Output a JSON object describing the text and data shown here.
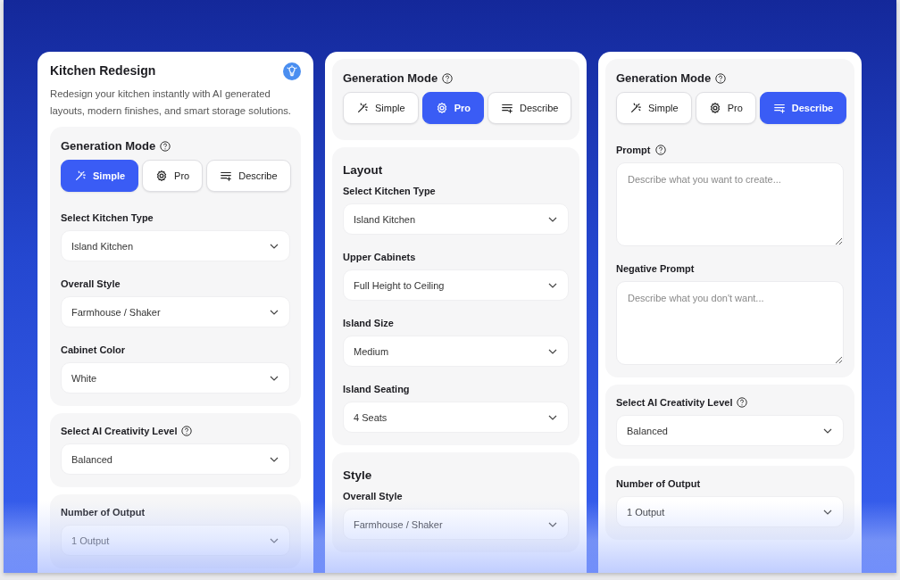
{
  "panels": [
    {
      "title": "Kitchen Redesign",
      "description": "Redesign your kitchen instantly with AI generated layouts, modern finishes, and smart storage solutions.",
      "sections": [
        {
          "fields": [
            {
              "kind": "modes",
              "label": "Generation Mode",
              "help": true,
              "modes": [
                {
                  "label": "Simple",
                  "selected": true
                },
                {
                  "label": "Pro",
                  "selected": false
                },
                {
                  "label": "Describe",
                  "selected": false
                }
              ]
            },
            {
              "kind": "select",
              "label": "Select Kitchen Type",
              "value": "Island Kitchen"
            },
            {
              "kind": "select",
              "label": "Overall Style",
              "value": "Farmhouse / Shaker"
            },
            {
              "kind": "select",
              "label": "Cabinet Color",
              "value": "White"
            }
          ]
        },
        {
          "fields": [
            {
              "kind": "select",
              "label": "Select AI Creativity Level",
              "help": true,
              "value": "Balanced"
            }
          ]
        },
        {
          "fields": [
            {
              "kind": "select",
              "label": "Number of Output",
              "value": "1 Output"
            }
          ]
        }
      ]
    },
    {
      "sections": [
        {
          "fields": [
            {
              "kind": "modes",
              "label": "Generation Mode",
              "help": true,
              "modes": [
                {
                  "label": "Simple",
                  "selected": false
                },
                {
                  "label": "Pro",
                  "selected": true
                },
                {
                  "label": "Describe",
                  "selected": false
                }
              ]
            }
          ]
        },
        {
          "heading": "Layout",
          "fields": [
            {
              "kind": "select",
              "label": "Select Kitchen Type",
              "value": "Island Kitchen"
            },
            {
              "kind": "select",
              "label": "Upper Cabinets",
              "value": "Full Height to Ceiling"
            },
            {
              "kind": "select",
              "label": "Island Size",
              "value": "Medium"
            },
            {
              "kind": "select",
              "label": "Island Seating",
              "value": "4 Seats"
            }
          ]
        },
        {
          "heading": "Style",
          "fields": [
            {
              "kind": "select",
              "label": "Overall Style",
              "value": "Farmhouse / Shaker"
            }
          ]
        }
      ]
    },
    {
      "sections": [
        {
          "fields": [
            {
              "kind": "modes",
              "label": "Generation Mode",
              "help": true,
              "modes": [
                {
                  "label": "Simple",
                  "selected": false
                },
                {
                  "label": "Pro",
                  "selected": false
                },
                {
                  "label": "Describe",
                  "selected": true
                }
              ]
            },
            {
              "kind": "textarea",
              "label": "Prompt",
              "help": true,
              "placeholder": "Describe what you want to create..."
            },
            {
              "kind": "textarea",
              "label": "Negative Prompt",
              "placeholder": "Describe what you don't want..."
            }
          ]
        },
        {
          "fields": [
            {
              "kind": "select",
              "label": "Select AI Creativity Level",
              "help": true,
              "value": "Balanced"
            }
          ]
        },
        {
          "fields": [
            {
              "kind": "select",
              "label": "Number of Output",
              "value": "1 Output"
            }
          ]
        }
      ]
    }
  ]
}
